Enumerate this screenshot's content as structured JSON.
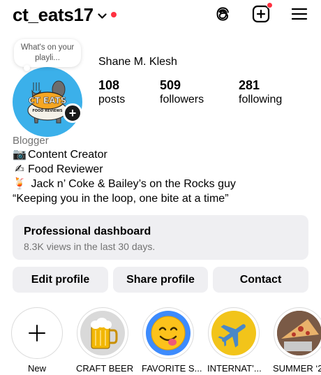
{
  "header": {
    "username": "ct_eats17",
    "icons": [
      "threads-icon",
      "new-post-icon",
      "menu-icon"
    ]
  },
  "profile": {
    "display_name": "Shane M. Klesh",
    "note": "What's on your playli...",
    "avatar_text": "CT EATS",
    "avatar_subtext": "FOOD REVIEWS",
    "add_badge": "+",
    "stats": {
      "posts": {
        "value": "108",
        "label": "posts"
      },
      "followers": {
        "value": "509",
        "label": "followers"
      },
      "following": {
        "value": "281",
        "label": "following"
      }
    }
  },
  "bio": {
    "category": "Blogger",
    "lines": [
      {
        "emoji": "📷",
        "text": "Content Creator"
      },
      {
        "emoji": "✍",
        "text": "Food Reviewer"
      },
      {
        "emoji": "🍹",
        "text": " Jack n’ Coke & Bailey’s on the Rocks guy"
      },
      {
        "emoji": "",
        "text": "“Keeping you in the loop, one bite at a time”"
      }
    ]
  },
  "dashboard": {
    "title": "Professional dashboard",
    "subtitle": "8.3K views in the last 30 days."
  },
  "actions": {
    "edit": "Edit profile",
    "share": "Share profile",
    "contact": "Contact"
  },
  "highlights": [
    {
      "label": "New",
      "icon": "plus-icon"
    },
    {
      "label": "CRAFT BEER",
      "icon": "beer-mug-icon"
    },
    {
      "label": "FAVORITE S...",
      "icon": "yum-face-icon"
    },
    {
      "label": "INTERNAT’...",
      "icon": "airplane-icon"
    },
    {
      "label": "SUMMER ‘2",
      "icon": "pizza-photo"
    }
  ],
  "colors": {
    "notification_dot": "#ff3040",
    "avatar_bg": "#3bb0ea",
    "button_bg": "#efeff2",
    "secondary_text": "#737373"
  }
}
